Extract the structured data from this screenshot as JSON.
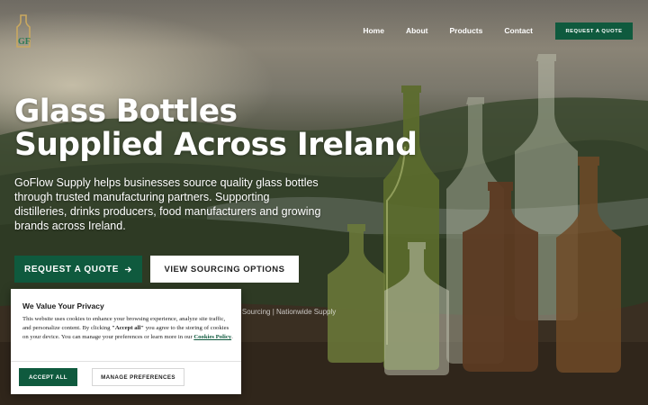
{
  "brand": {
    "logo_text": "GF",
    "logo_icon": "bottle-logo-icon"
  },
  "nav": {
    "items": [
      {
        "label": "Home"
      },
      {
        "label": "About"
      },
      {
        "label": "Products"
      },
      {
        "label": "Contact"
      }
    ],
    "cta_label": "REQUEST A QUOTE"
  },
  "hero": {
    "headline_line1": "Glass Bottles",
    "headline_line2": "Supplied Across Ireland",
    "lede": "GoFlow Supply helps businesses source quality glass bottles through trusted manufacturing partners. Supporting distilleries, drinks producers, food manufacturers and growing brands across Ireland.",
    "primary_cta": "REQUEST A QUOTE",
    "primary_cta_icon": "arrow-right-icon",
    "secondary_cta": "VIEW SOURCING OPTIONS",
    "tagline": "ttle Sourcing | Nationwide Supply"
  },
  "cookie_banner": {
    "title": "We Value Your Privacy",
    "body_part1": "This website uses cookies to enhance your browsing experience, analyze site traffic, and personalize content. By clicking ",
    "body_accept_quote": "\"Accept all\"",
    "body_part2": " you agree to the storing of cookies on your device. You can manage your preferences or learn more in our ",
    "policy_link": "Cookies Policy",
    "body_end": ".",
    "accept_label": "ACCEPT ALL",
    "manage_label": "MANAGE PREFERENCES"
  },
  "colors": {
    "accent": "#0f5a3e",
    "white": "#ffffff"
  }
}
